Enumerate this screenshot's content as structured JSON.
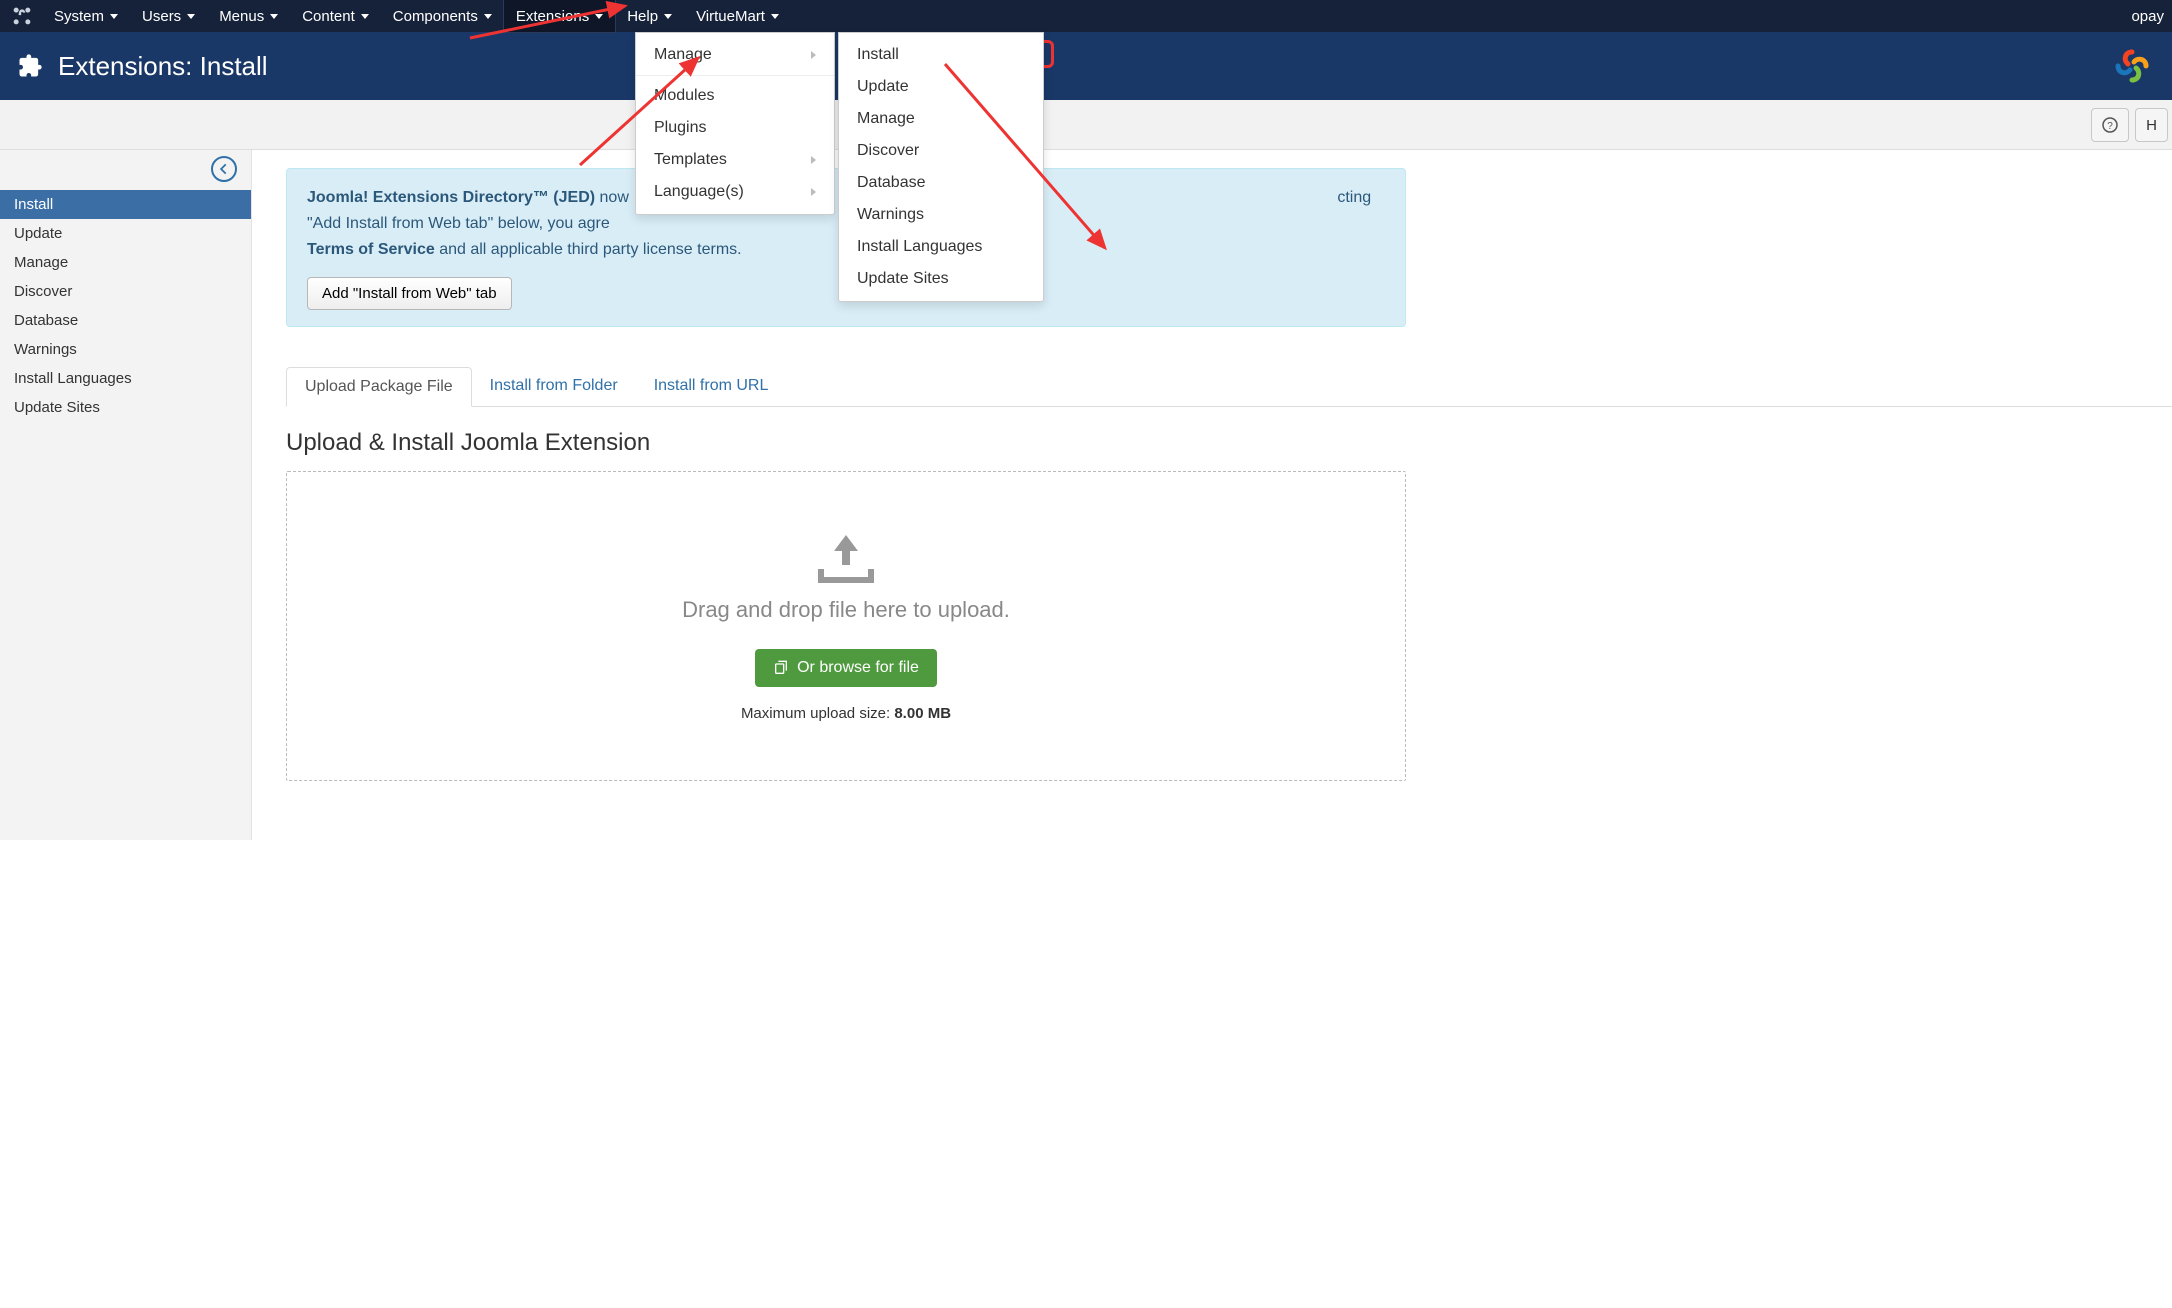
{
  "topmenu": [
    "System",
    "Users",
    "Menus",
    "Content",
    "Components",
    "Extensions",
    "Help",
    "VirtueMart"
  ],
  "topmenu_active_index": 5,
  "user_label": "opay",
  "header": {
    "title": "Extensions: Install"
  },
  "toolbar": {
    "help_label": "H"
  },
  "sidebar": {
    "items": [
      "Install",
      "Update",
      "Manage",
      "Discover",
      "Database",
      "Warnings",
      "Install Languages",
      "Update Sites"
    ],
    "active_index": 0
  },
  "alert": {
    "bold1": "Joomla! Extensions Directory™ (JED)",
    "text1_a": " now",
    "text1_b": "cting \"Add Install from Web tab\" below, you agre",
    "bold2": "Terms of Service",
    "text2": " and all applicable third party license terms.",
    "button": "Add \"Install from Web\" tab"
  },
  "tabs": {
    "items": [
      "Upload Package File",
      "Install from Folder",
      "Install from URL"
    ],
    "active_index": 0
  },
  "section_title": "Upload & Install Joomla Extension",
  "dropzone": {
    "text": "Drag and drop file here to upload.",
    "browse": "Or browse for file",
    "max_label": "Maximum upload size: ",
    "max_value": "8.00 MB"
  },
  "ext_menu": {
    "items": [
      {
        "label": "Manage",
        "has_sub": true
      },
      {
        "divider": true
      },
      {
        "label": "Modules"
      },
      {
        "label": "Plugins"
      },
      {
        "label": "Templates",
        "has_sub": true
      },
      {
        "label": "Language(s)",
        "has_sub": true
      }
    ]
  },
  "manage_submenu": {
    "items": [
      "Install",
      "Update",
      "Manage",
      "Discover",
      "Database",
      "Warnings",
      "Install Languages",
      "Update Sites"
    ],
    "highlighted_index": 0
  }
}
